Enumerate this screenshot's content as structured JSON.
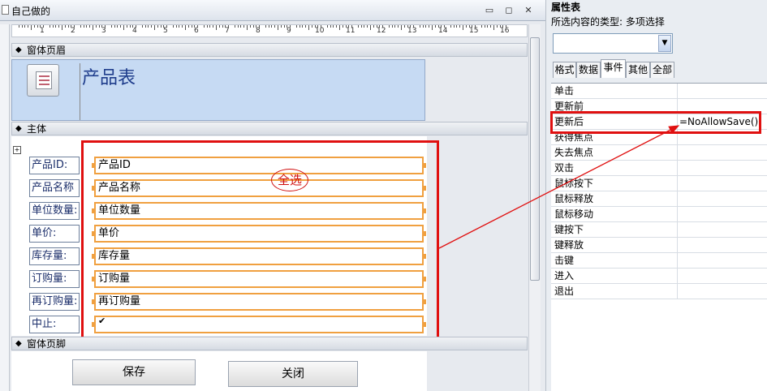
{
  "window": {
    "title": "自己做的",
    "min_glyph": "▭",
    "restore_glyph": "◻",
    "close_glyph": "✕"
  },
  "ruler": {
    "numbers": [
      "1",
      "2",
      "3",
      "4",
      "5",
      "6",
      "7",
      "8",
      "9",
      "10",
      "11",
      "12",
      "13",
      "14",
      "15",
      "16"
    ]
  },
  "sections": {
    "header": "窗体页眉",
    "detail": "主体",
    "footer": "窗体页脚"
  },
  "header": {
    "title": "产品表"
  },
  "fields": [
    {
      "label": "产品ID:",
      "control": "产品ID"
    },
    {
      "label": "产品名称",
      "control": "产品名称"
    },
    {
      "label": "单位数量:",
      "control": "单位数量"
    },
    {
      "label": "单价:",
      "control": "单价"
    },
    {
      "label": "库存量:",
      "control": "库存量"
    },
    {
      "label": "订购量:",
      "control": "订购量"
    },
    {
      "label": "再订购量:",
      "control": "再订购量"
    },
    {
      "label": "中止:",
      "control": "✔"
    }
  ],
  "annotation": {
    "select_all": "全选"
  },
  "footer_buttons": {
    "save": "保存",
    "close": "关闭"
  },
  "property_sheet": {
    "title": "属性表",
    "selection_type": "所选内容的类型: 多项选择",
    "combo_value": "",
    "tabs": [
      "格式",
      "数据",
      "事件",
      "其他",
      "全部"
    ],
    "active_tab": "事件",
    "rows": [
      {
        "name": "单击",
        "value": ""
      },
      {
        "name": "更新前",
        "value": ""
      },
      {
        "name": "更新后",
        "value": "=NoAllowSave()"
      },
      {
        "name": "获得焦点",
        "value": ""
      },
      {
        "name": "失去焦点",
        "value": ""
      },
      {
        "name": "双击",
        "value": ""
      },
      {
        "name": "鼠标按下",
        "value": ""
      },
      {
        "name": "鼠标释放",
        "value": ""
      },
      {
        "name": "鼠标移动",
        "value": ""
      },
      {
        "name": "键按下",
        "value": ""
      },
      {
        "name": "键释放",
        "value": ""
      },
      {
        "name": "击键",
        "value": ""
      },
      {
        "name": "进入",
        "value": ""
      },
      {
        "name": "退出",
        "value": ""
      }
    ]
  },
  "colors": {
    "annotation_red": "#e01010",
    "selection_orange": "#f0a040"
  }
}
